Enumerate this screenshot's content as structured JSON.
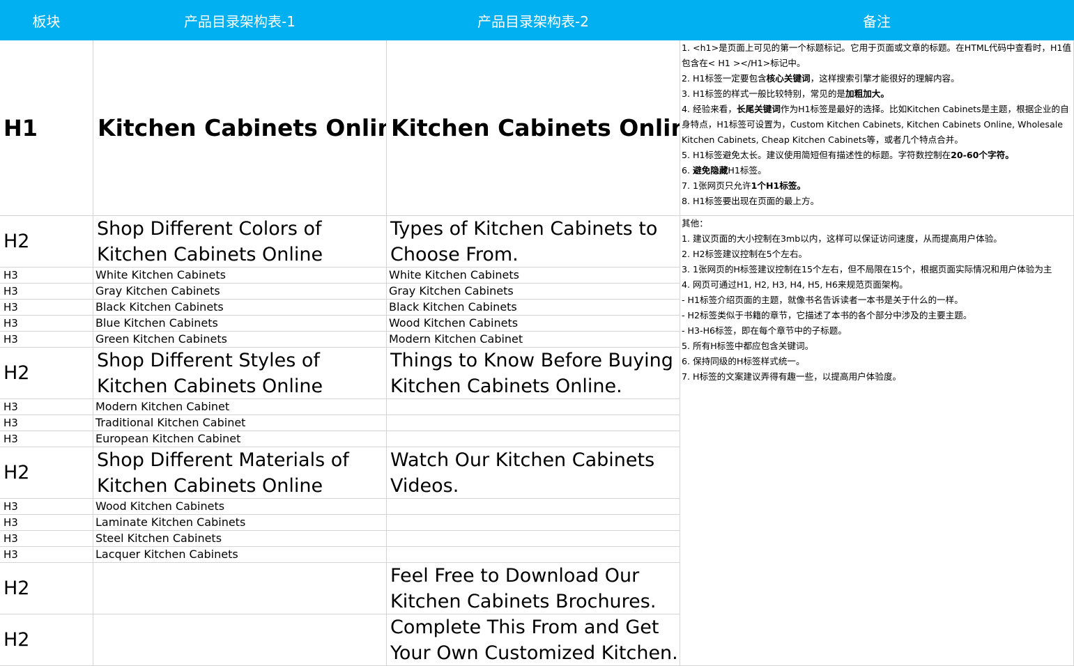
{
  "header": {
    "col_block": "板块",
    "col_table1": "产品目录架构表-1",
    "col_table2": "产品目录架构表-2",
    "col_notes": "备注"
  },
  "rows": {
    "r1": {
      "level": "H1",
      "t1": "Kitchen Cabinets Online",
      "t2": "Kitchen Cabinets Online"
    },
    "r2": {
      "level": "H2",
      "t1": "Shop Different Colors of Kitchen Cabinets Online",
      "t2": "Types of Kitchen Cabinets to Choose From."
    },
    "r3": {
      "level": "H3",
      "t1": "White Kitchen Cabinets",
      "t2": "White Kitchen Cabinets"
    },
    "r4": {
      "level": "H3",
      "t1": "Gray Kitchen Cabinets",
      "t2": "Gray Kitchen Cabinets"
    },
    "r5": {
      "level": "H3",
      "t1": "Black Kitchen Cabinets",
      "t2": "Black Kitchen Cabinets"
    },
    "r6": {
      "level": "H3",
      "t1": "Blue Kitchen Cabinets",
      "t2": "Wood Kitchen Cabinets"
    },
    "r7": {
      "level": "H3",
      "t1": "Green Kitchen Cabinets",
      "t2": "Modern Kitchen Cabinet"
    },
    "r8": {
      "level": "H2",
      "t1": "Shop Different Styles of Kitchen Cabinets Online",
      "t2": "Things to Know Before Buying Kitchen Cabinets Online."
    },
    "r9": {
      "level": "H3",
      "t1": "Modern Kitchen Cabinet",
      "t2": ""
    },
    "r10": {
      "level": "H3",
      "t1": "Traditional Kitchen Cabinet",
      "t2": ""
    },
    "r11": {
      "level": "H3",
      "t1": "European Kitchen Cabinet",
      "t2": ""
    },
    "r12": {
      "level": "H2",
      "t1": "Shop Different Materials of Kitchen Cabinets Online",
      "t2": "Watch Our Kitchen Cabinets Videos."
    },
    "r13": {
      "level": "H3",
      "t1": "Wood Kitchen Cabinets",
      "t2": ""
    },
    "r14": {
      "level": "H3",
      "t1": "Laminate Kitchen Cabinets",
      "t2": ""
    },
    "r15": {
      "level": "H3",
      "t1": "Steel Kitchen Cabinets",
      "t2": ""
    },
    "r16": {
      "level": "H3",
      "t1": "Lacquer Kitchen Cabinets",
      "t2": ""
    },
    "r17": {
      "level": "H2",
      "t1": "",
      "t2": "Feel Free to Download Our Kitchen Cabinets Brochures."
    },
    "r18": {
      "level": "H2",
      "t1": "",
      "t2": "Complete This From and Get Your Own Customized Kitchen."
    }
  },
  "notes_h1": {
    "n1": "1. <h1>是页面上可见的第一个标题标记。它用于页面或文章的标题。在HTML代码中查看时，H1值包含在< H1 ></H1>标记中。",
    "n2a": "2. H1标签一定要包含",
    "n2b": "核心关键词",
    "n2c": "，这样搜索引擎才能很好的理解内容。",
    "n3a": "3. H1标签的样式一般比较特别，常见的是",
    "n3b": "加粗加大。",
    "n4a": "4. 经验来看，",
    "n4b": "长尾关键词",
    "n4c": "作为H1标签是最好的选择。比如Kitchen Cabinets是主题，根据企业的自身特点，H1标签可设置为，Custom Kitchen Cabinets, Kitchen Cabinets Online, Wholesale Kitchen Cabinets, Cheap Kitchen Cabinets等，或者几个特点合并。",
    "n5a": "5. H1标签避免太长。建议使用简短但有描述性的标题。字符数控制在",
    "n5b": "20-60个字符。",
    "n6a": "6. ",
    "n6b": "避免隐藏",
    "n6c": "H1标签。",
    "n7a": "7. 1张网页只允许",
    "n7b": "1个H1标签。",
    "n8": "8. H1标签要出现在页面的最上方。"
  },
  "notes_other": {
    "title": "其他：",
    "n1": "1. 建议页面的大小控制在3mb以内，这样可以保证访问速度，从而提高用户体验。",
    "n2": "2. H2标签建议控制在5个左右。",
    "n3": "3. 1张网页的H标签建议控制在15个左右，但不局限在15个，根据页面实际情况和用户体验为主",
    "n4": "4. 网页可通过H1, H2, H3, H4, H5, H6来规范页面架构。",
    "n4a": "- H1标签介绍页面的主题，就像书名告诉读者一本书是关于什么的一样。",
    "n4b": "- H2标签类似于书籍的章节，它描述了本书的各个部分中涉及的主要主题。",
    "n4c": "- H3-H6标签，即在每个章节中的子标题。",
    "n5": "5. 所有H标签中都应包含关键词。",
    "n6": "6. 保持同级的H标签样式统一。",
    "n7": "7. H标签的文案建议弄得有趣一些，以提高用户体验度。"
  },
  "colors": {
    "header_bg": "#00b0f0",
    "header_text": "#ffffff",
    "grid": "#d4d4d4"
  }
}
